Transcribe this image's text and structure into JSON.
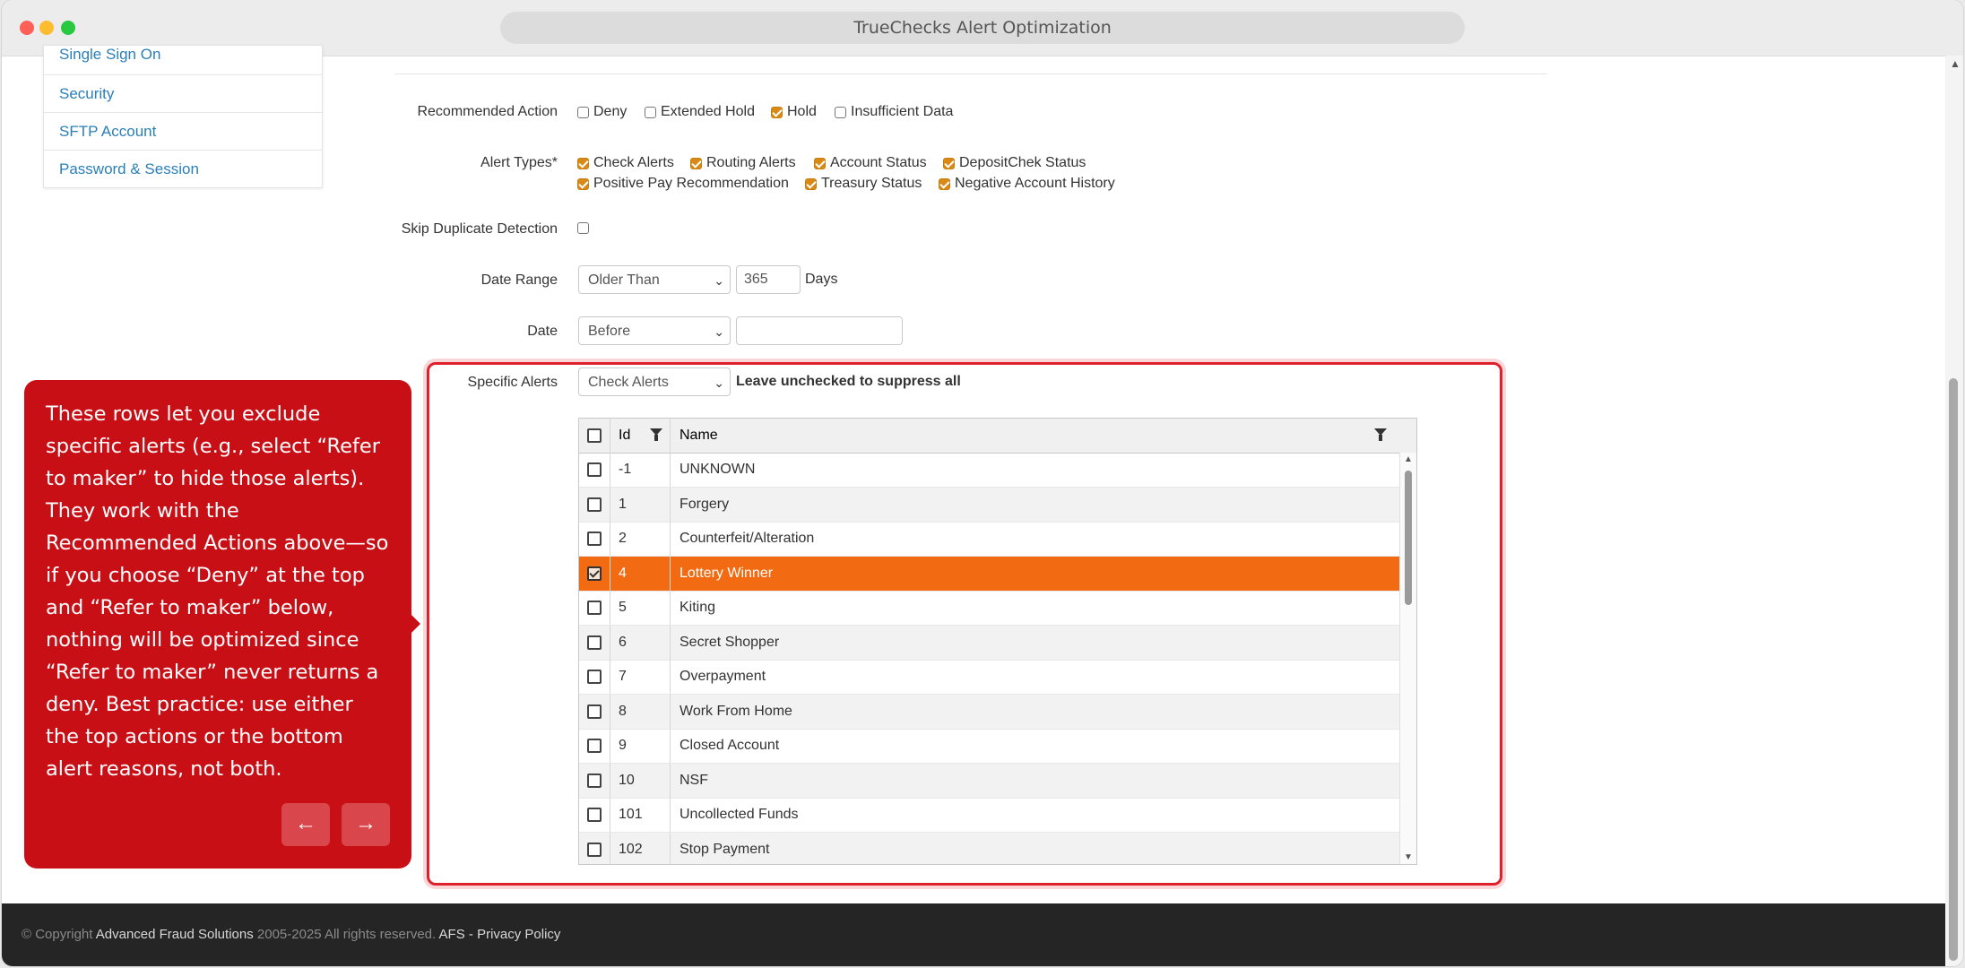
{
  "window": {
    "title": "TrueChecks Alert Optimization"
  },
  "sidebar": {
    "items": [
      {
        "label": "Single Sign On"
      },
      {
        "label": "Security"
      },
      {
        "label": "SFTP Account"
      },
      {
        "label": "Password & Session"
      }
    ]
  },
  "form": {
    "recommended_action": {
      "label": "Recommended Action",
      "options": [
        {
          "label": "Deny",
          "checked": false
        },
        {
          "label": "Extended Hold",
          "checked": false
        },
        {
          "label": "Hold",
          "checked": true
        },
        {
          "label": "Insufficient Data",
          "checked": false
        }
      ]
    },
    "alert_types": {
      "label": "Alert Types*",
      "options": [
        {
          "label": "Check Alerts",
          "checked": true
        },
        {
          "label": "Routing Alerts",
          "checked": true
        },
        {
          "label": "Account Status",
          "checked": true
        },
        {
          "label": "DepositChek Status",
          "checked": true
        },
        {
          "label": "Positive Pay Recommendation",
          "checked": true
        },
        {
          "label": "Treasury Status",
          "checked": true
        },
        {
          "label": "Negative Account History",
          "checked": true
        }
      ]
    },
    "skip_duplicate": {
      "label": "Skip Duplicate Detection",
      "checked": false
    },
    "date_range": {
      "label": "Date Range",
      "selected": "Older Than",
      "value": "365",
      "unit": "Days"
    },
    "date": {
      "label": "Date",
      "selected": "Before",
      "value": ""
    },
    "specific_alerts": {
      "label": "Specific Alerts",
      "selected": "Check Alerts",
      "hint": "Leave unchecked to suppress all"
    }
  },
  "grid": {
    "columns": {
      "id": "Id",
      "name": "Name"
    },
    "rows": [
      {
        "id": "-1",
        "name": "UNKNOWN",
        "checked": false
      },
      {
        "id": "1",
        "name": "Forgery",
        "checked": false
      },
      {
        "id": "2",
        "name": "Counterfeit/Alteration",
        "checked": false
      },
      {
        "id": "4",
        "name": "Lottery Winner",
        "checked": true
      },
      {
        "id": "5",
        "name": "Kiting",
        "checked": false
      },
      {
        "id": "6",
        "name": "Secret Shopper",
        "checked": false
      },
      {
        "id": "7",
        "name": "Overpayment",
        "checked": false
      },
      {
        "id": "8",
        "name": "Work From Home",
        "checked": false
      },
      {
        "id": "9",
        "name": "Closed Account",
        "checked": false
      },
      {
        "id": "10",
        "name": "NSF",
        "checked": false
      },
      {
        "id": "101",
        "name": "Uncollected Funds",
        "checked": false
      },
      {
        "id": "102",
        "name": "Stop Payment",
        "checked": false
      }
    ]
  },
  "tooltip": {
    "text": "These rows let you exclude specific alerts (e.g., select “Refer to maker” to hide those alerts). They work with the Recommended Actions above—so if you choose “Deny” at the top and “Refer to maker” below, nothing will be optimized since “Refer to maker” never returns a deny. Best practice: use either the top actions or the bottom alert reasons, not both.",
    "prev": "←",
    "next": "→"
  },
  "footer": {
    "copyright": "© Copyright",
    "company": "Advanced Fraud Solutions",
    "years": "2005-2025 All rights reserved.",
    "afs": "AFS",
    "separator": "-",
    "privacy": "Privacy Policy"
  },
  "colors": {
    "accent": "#d98a16",
    "selected_row": "#f26b12",
    "tooltip": "#c80f16",
    "highlight": "#e0202a"
  }
}
